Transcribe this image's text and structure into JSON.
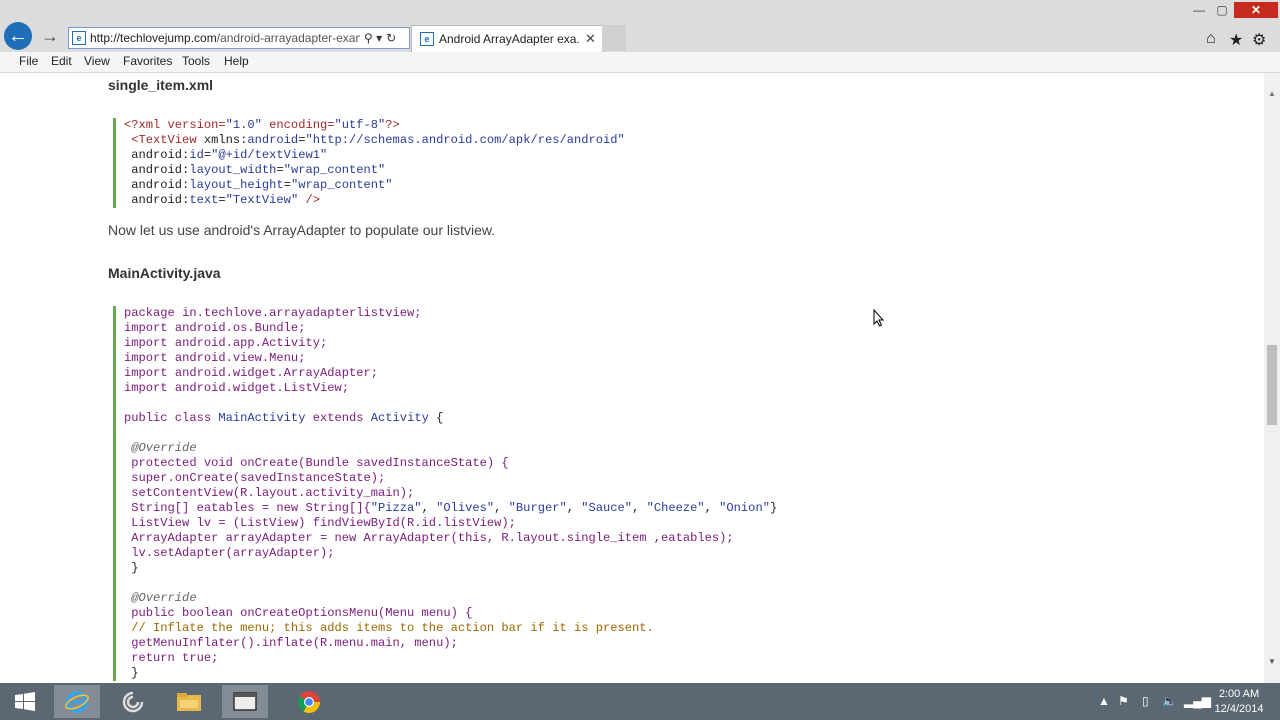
{
  "browser": {
    "address_url_host": "http://techlovejump.com",
    "address_url_path": "/android-arrayadapter-exam",
    "tab_title": "Android ArrayAdapter exa...",
    "tab_close": "✕",
    "search_glyph": "⚲ ▾",
    "refresh_glyph": "↻"
  },
  "window_controls": {
    "minimize": "—",
    "maximize": "▢",
    "close": "✕"
  },
  "toolbar_icons": {
    "home": "⌂",
    "favorites": "★",
    "tools": "⚙"
  },
  "menu": {
    "items": [
      "File",
      "Edit",
      "View",
      "Favorites",
      "Tools",
      "Help"
    ]
  },
  "article": {
    "heading1": "single_item.xml",
    "xml_code": [
      [
        {
          "t": "<?xml version=",
          "c": "tag"
        },
        {
          "t": "\"1.0\"",
          "c": "str"
        },
        {
          "t": " encoding=",
          "c": "tag"
        },
        {
          "t": "\"utf-8\"",
          "c": "str"
        },
        {
          "t": "?>",
          "c": "tag"
        }
      ],
      [
        {
          "t": " <TextView ",
          "c": "tag"
        },
        {
          "t": "xmlns:",
          "c": "plain"
        },
        {
          "t": "android",
          "c": "attr"
        },
        {
          "t": "=",
          "c": "plain"
        },
        {
          "t": "\"http://schemas.android.com/apk/res/android\"",
          "c": "str"
        }
      ],
      [
        {
          "t": " android:",
          "c": "plain"
        },
        {
          "t": "id",
          "c": "attr"
        },
        {
          "t": "=",
          "c": "plain"
        },
        {
          "t": "\"@+id/textView1\"",
          "c": "str"
        }
      ],
      [
        {
          "t": " android:",
          "c": "plain"
        },
        {
          "t": "layout_width",
          "c": "attr"
        },
        {
          "t": "=",
          "c": "plain"
        },
        {
          "t": "\"wrap_content\"",
          "c": "str"
        }
      ],
      [
        {
          "t": " android:",
          "c": "plain"
        },
        {
          "t": "layout_height",
          "c": "attr"
        },
        {
          "t": "=",
          "c": "plain"
        },
        {
          "t": "\"wrap_content\"",
          "c": "str"
        }
      ],
      [
        {
          "t": " android:",
          "c": "plain"
        },
        {
          "t": "text",
          "c": "attr"
        },
        {
          "t": "=",
          "c": "plain"
        },
        {
          "t": "\"TextView\"",
          "c": "str"
        },
        {
          "t": " />",
          "c": "tag"
        }
      ]
    ],
    "paragraph": "Now let us use android's ArrayAdapter to populate our listview.",
    "heading2": "MainActivity.java",
    "java_code": [
      [
        {
          "t": "package ",
          "c": "kw"
        },
        {
          "t": "in.techlove.arrayadapterlistview;",
          "c": "decl"
        }
      ],
      [
        {
          "t": "import ",
          "c": "kw"
        },
        {
          "t": "android.os.Bundle;",
          "c": "decl"
        }
      ],
      [
        {
          "t": "import ",
          "c": "kw"
        },
        {
          "t": "android.app.Activity;",
          "c": "decl"
        }
      ],
      [
        {
          "t": "import ",
          "c": "kw"
        },
        {
          "t": "android.view.Menu;",
          "c": "decl"
        }
      ],
      [
        {
          "t": "import ",
          "c": "kw"
        },
        {
          "t": "android.widget.ArrayAdapter;",
          "c": "decl"
        }
      ],
      [
        {
          "t": "import ",
          "c": "kw"
        },
        {
          "t": "android.widget.ListView;",
          "c": "decl"
        }
      ],
      [],
      [
        {
          "t": "public class ",
          "c": "kw"
        },
        {
          "t": "MainActivity ",
          "c": "cls"
        },
        {
          "t": "extends ",
          "c": "kw"
        },
        {
          "t": "Activity ",
          "c": "cls"
        },
        {
          "t": "{",
          "c": "plain"
        }
      ],
      [],
      [
        {
          "t": " @Override",
          "c": "ann"
        }
      ],
      [
        {
          "t": " protected void ",
          "c": "kw"
        },
        {
          "t": "onCreate(Bundle savedInstanceState) {",
          "c": "decl"
        }
      ],
      [
        {
          "t": " super.onCreate(savedInstanceState);",
          "c": "decl"
        }
      ],
      [
        {
          "t": " setContentView(R.layout.activity_main);",
          "c": "decl"
        }
      ],
      [
        {
          "t": " String[] eatables = ",
          "c": "decl"
        },
        {
          "t": "new ",
          "c": "kw"
        },
        {
          "t": "String[]{",
          "c": "decl"
        },
        {
          "t": "\"Pizza\"",
          "c": "str"
        },
        {
          "t": ", ",
          "c": "plain"
        },
        {
          "t": "\"Olives\"",
          "c": "str"
        },
        {
          "t": ", ",
          "c": "plain"
        },
        {
          "t": "\"Burger\"",
          "c": "str"
        },
        {
          "t": ", ",
          "c": "plain"
        },
        {
          "t": "\"Sauce\"",
          "c": "str"
        },
        {
          "t": ", ",
          "c": "plain"
        },
        {
          "t": "\"Cheeze\"",
          "c": "str"
        },
        {
          "t": ", ",
          "c": "plain"
        },
        {
          "t": "\"Onion\"",
          "c": "str"
        },
        {
          "t": "}",
          "c": "plain"
        }
      ],
      [
        {
          "t": " ListView lv = (ListView) findViewById(R.id.listView);",
          "c": "decl"
        }
      ],
      [
        {
          "t": " ArrayAdapter arrayAdapter = ",
          "c": "decl"
        },
        {
          "t": "new ",
          "c": "kw"
        },
        {
          "t": "ArrayAdapter(this, R.layout.single_item ,eatables);",
          "c": "decl"
        }
      ],
      [
        {
          "t": " lv.setAdapter(arrayAdapter);",
          "c": "decl"
        }
      ],
      [
        {
          "t": " }",
          "c": "plain"
        }
      ],
      [],
      [
        {
          "t": " @Override",
          "c": "ann"
        }
      ],
      [
        {
          "t": " public boolean ",
          "c": "kw"
        },
        {
          "t": "onCreateOptionsMenu(Menu menu) {",
          "c": "decl"
        }
      ],
      [
        {
          "t": " // Inflate the menu; this adds items to the action bar if it is present.",
          "c": "comment"
        }
      ],
      [
        {
          "t": " getMenuInflater().inflate(R.menu.main, menu);",
          "c": "decl"
        }
      ],
      [
        {
          "t": " return true;",
          "c": "kw"
        }
      ],
      [
        {
          "t": " }",
          "c": "plain"
        }
      ]
    ]
  },
  "taskbar": {
    "clock_time": "2:00 AM",
    "clock_date": "12/4/2014"
  },
  "colors": {
    "accent_blue": "#1e6fb8",
    "code_border": "#6aa84f",
    "close_red": "#c42b1c",
    "taskbar": "#5b6772"
  }
}
